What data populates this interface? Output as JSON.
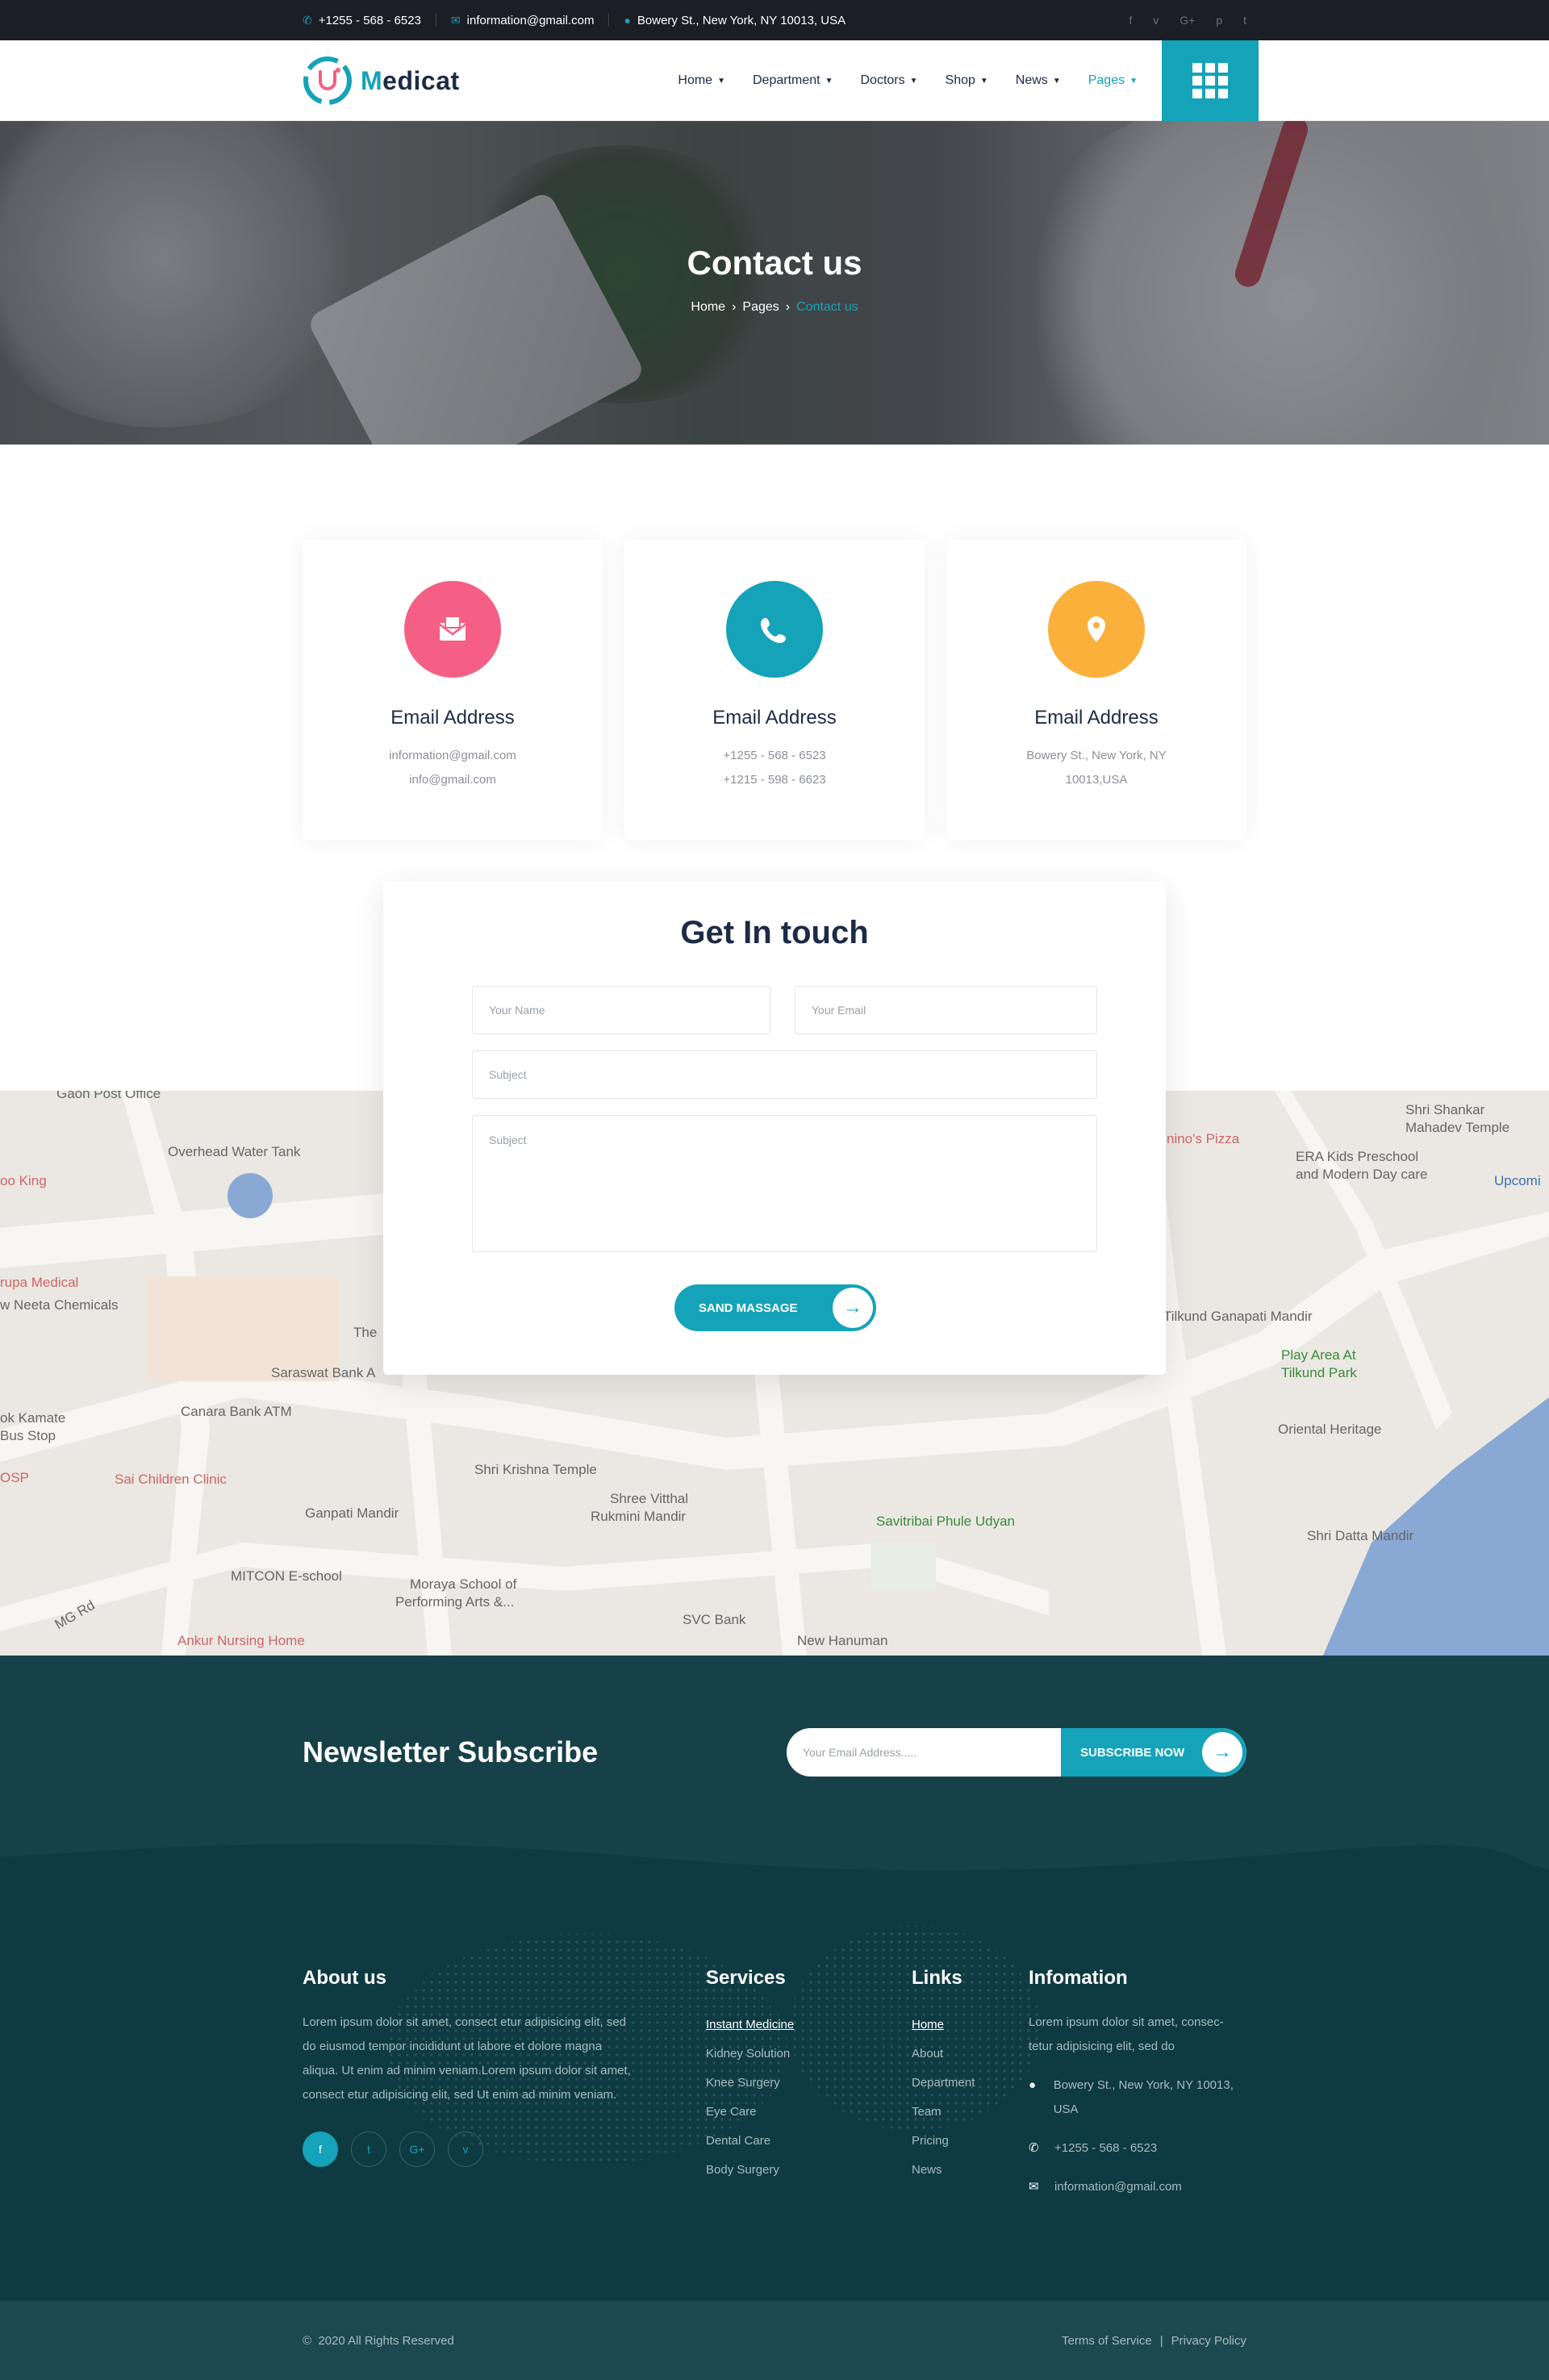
{
  "topbar": {
    "phone": "+1255 - 568 - 6523",
    "email": "information@gmail.com",
    "address": "Bowery St., New York, NY 10013, USA",
    "social": [
      "f",
      "v",
      "G+",
      "p",
      "t"
    ]
  },
  "nav": {
    "brand_first": "M",
    "brand_rest": "edicat",
    "items": [
      {
        "label": "Home"
      },
      {
        "label": "Department"
      },
      {
        "label": "Doctors"
      },
      {
        "label": "Shop"
      },
      {
        "label": "News"
      },
      {
        "label": "Pages"
      }
    ]
  },
  "hero": {
    "title": "Contact us",
    "crumbs": [
      "Home",
      "Pages",
      "Contact us"
    ]
  },
  "cards": [
    {
      "title": "Email Address",
      "line1": "information@gmail.com",
      "line2": "info@gmail.com",
      "color": "#f65f85",
      "icon": "envelope-icon"
    },
    {
      "title": "Email Address",
      "line1": "+1255 - 568 - 6523",
      "line2": "+1215 - 598 - 6623",
      "color": "#14a3b8",
      "icon": "phone-icon"
    },
    {
      "title": "Email Address",
      "line1": "Bowery St., New York, NY",
      "line2": "10013,USA",
      "color": "#fbb03b",
      "icon": "location-pin-icon"
    }
  ],
  "form": {
    "title": "Get In touch",
    "name_placeholder": "Your Name",
    "email_placeholder": "Your Email",
    "subject_placeholder": "Subject",
    "message_placeholder": "Subject",
    "submit_label": "SAND MASSAGE"
  },
  "map": {
    "labels": [
      "Gaon Post Office",
      "Overhead Water Tank",
      "oo King",
      "rupa Medical",
      "w Neeta Chemicals",
      "The",
      "Saraswat Bank A",
      "Canara Bank ATM",
      "ok Kamate",
      "Bus Stop",
      "OSP",
      "Sai Children Clinic",
      "Shri Krishna Temple",
      "Shree Vitthal",
      "Rukmini Mandir",
      "Ganpati Mandir",
      "MITCON E-school",
      "Moraya School of",
      "Performing Arts &...",
      "Ankur Nursing Home",
      "MG Rd",
      "SVC Bank",
      "New Hanuman",
      "Savitribai Phule Udyan",
      "nino's Pizza",
      "Shri Shankar",
      "Mahadev Temple",
      "Upcomi",
      "ERA Kids Preschool",
      "and Modern Day care",
      "Tilkund Ganapati Mandir",
      "Play Area At",
      "Tilkund Park",
      "Oriental Heritage",
      "Shri Datta Mandir"
    ]
  },
  "newsletter": {
    "title": "Newsletter Subscribe",
    "placeholder": "Your Email Address.....",
    "button": "SUBSCRIBE NOW"
  },
  "footer": {
    "about_title": "About us",
    "about_text": "Lorem ipsum dolor sit amet, consect etur adipisicing elit, sed do eiusmod tempor incididunt ut labore et dolore magna aliqua. Ut enim ad minim veniam.Lorem ipsum dolor sit amet, consect etur adipisicing elit, sed Ut enim ad minim veniam.",
    "services_title": "Services",
    "services": [
      "Instant Medicine",
      "Kidney Solution",
      "Knee Surgery",
      "Eye Care",
      "Dental Care",
      "Body Surgery"
    ],
    "links_title": "Links",
    "links": [
      "Home",
      "About",
      "Department",
      "Team",
      "Pricing",
      "News"
    ],
    "info_title": "Infomation",
    "info_text": "Lorem ipsum dolor sit amet, consec- tetur adipisicing elit, sed do",
    "address": "Bowery St., New York, NY 10013, USA",
    "phone": "+1255 - 568 - 6523",
    "email": "information@gmail.com"
  },
  "bottom": {
    "copyright": "2020 All Rights Reserved",
    "terms": "Terms of Service",
    "privacy": "Privacy Policy",
    "separator": "|"
  },
  "colors": {
    "accent": "#14a3b8",
    "dark": "#1d2b45",
    "footer": "#0e3a42",
    "pink": "#f65f85",
    "yellow": "#fbb03b"
  }
}
